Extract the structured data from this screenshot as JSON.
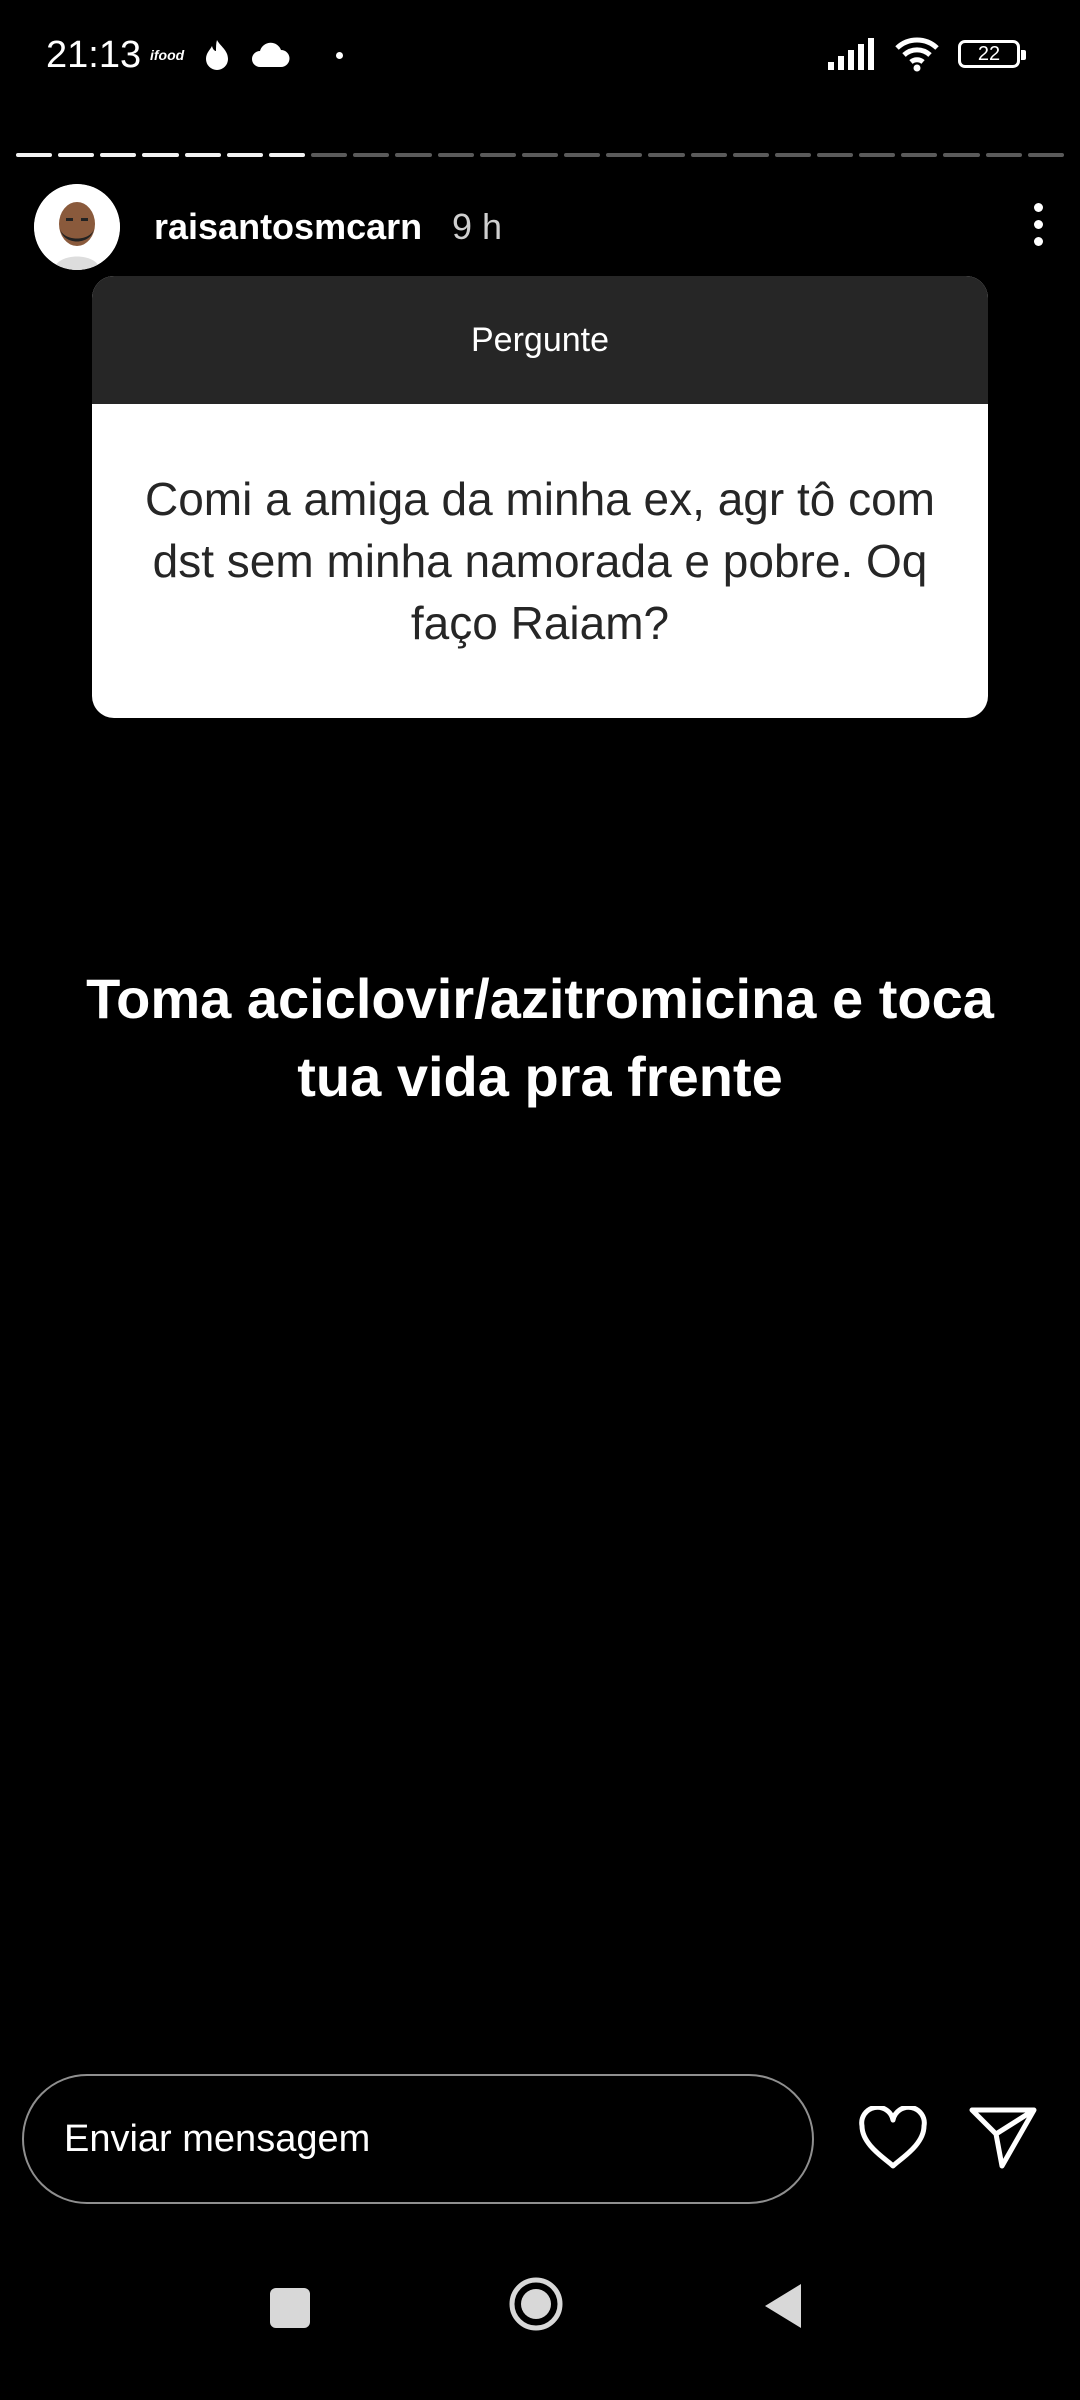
{
  "status_bar": {
    "time": "21:13",
    "app_icons": [
      "ifood-icon",
      "tinder-flame-icon",
      "cloud-icon",
      "dot-icon"
    ],
    "ifood_text": "ifood",
    "battery_level": "22",
    "signal_icon": "cellular-signal-icon",
    "wifi_icon": "wifi-icon"
  },
  "story": {
    "progress": {
      "segments_total": 25,
      "segments_viewed": 7
    },
    "username": "raisantosmcarn",
    "time_ago": "9 h",
    "question_card": {
      "header": "Pergunte",
      "question": "Comi a amiga da minha ex, agr tô com dst sem minha namorada e pobre. Oq faço Raiam?"
    },
    "answer_text": "Toma aciclovir/azitromicina e toca tua vida pra frente"
  },
  "reply_bar": {
    "placeholder": "Enviar mensagem",
    "like_icon": "heart-icon",
    "send_icon": "paper-plane-icon"
  },
  "nav_bar": {
    "buttons": [
      "recents-square-icon",
      "home-circle-icon",
      "back-triangle-icon"
    ]
  },
  "colors": {
    "background": "#000000",
    "card_header": "#262626",
    "card_body": "#ffffff",
    "card_text": "#262626",
    "progress_viewed": "#f2f2f2",
    "progress_pending": "#5a5a5a"
  }
}
